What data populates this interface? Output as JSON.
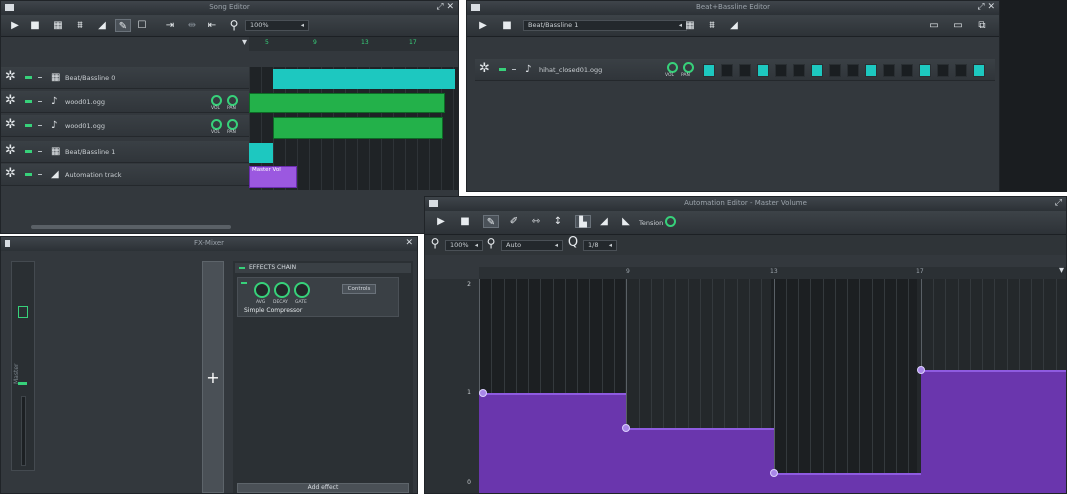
{
  "song_editor": {
    "title": "Song Editor",
    "zoom": "100%",
    "ruler": [
      "5",
      "9",
      "13",
      "17"
    ],
    "tracks": [
      {
        "name": "Beat/Bassline 0",
        "type": "bb"
      },
      {
        "name": "wood01.ogg",
        "type": "sample",
        "knob_vol": "VOL",
        "knob_pan": "PAN"
      },
      {
        "name": "wood01.ogg",
        "type": "sample",
        "knob_vol": "VOL",
        "knob_pan": "PAN"
      },
      {
        "name": "Beat/Bassline 1",
        "type": "bb"
      },
      {
        "name": "Automation track",
        "type": "automation"
      }
    ],
    "automation_clip_label": "Master Vol"
  },
  "bb_editor": {
    "title": "Beat+Bassline Editor",
    "selector_value": "Beat/Bassline 1",
    "track_name": "hihat_closed01.ogg",
    "knob_vol": "VOL",
    "knob_pan": "PAN",
    "steps": [
      1,
      0,
      0,
      1,
      0,
      0,
      1,
      0,
      0,
      1,
      0,
      0,
      1,
      0,
      0,
      1
    ]
  },
  "fx_mixer": {
    "title": "FX-Mixer",
    "channel_name": "Master",
    "effects_chain_label": "EFFECTS CHAIN",
    "effect_name": "Simple Compressor",
    "control_button": "Controls",
    "knob_labels": [
      "AVG",
      "DECAY",
      "GATE"
    ],
    "add_effect": "Add effect",
    "add_channel": "+"
  },
  "automation_editor": {
    "title": "Automation Editor - Master Volume",
    "tension_label": "Tension",
    "zoom_x": "100%",
    "zoom_y": "Auto",
    "quantize": "1/8",
    "ruler": [
      "9",
      "13",
      "17"
    ],
    "y_labels": [
      "2",
      "1",
      "0"
    ],
    "levels": [
      0.47,
      0.31,
      0.1,
      0.58
    ]
  },
  "colors": {
    "teal": "#1dc8c0",
    "green": "#23b14a",
    "purple": "#9b58e0",
    "accent": "#37d17a",
    "window_bg": "#33383d"
  }
}
